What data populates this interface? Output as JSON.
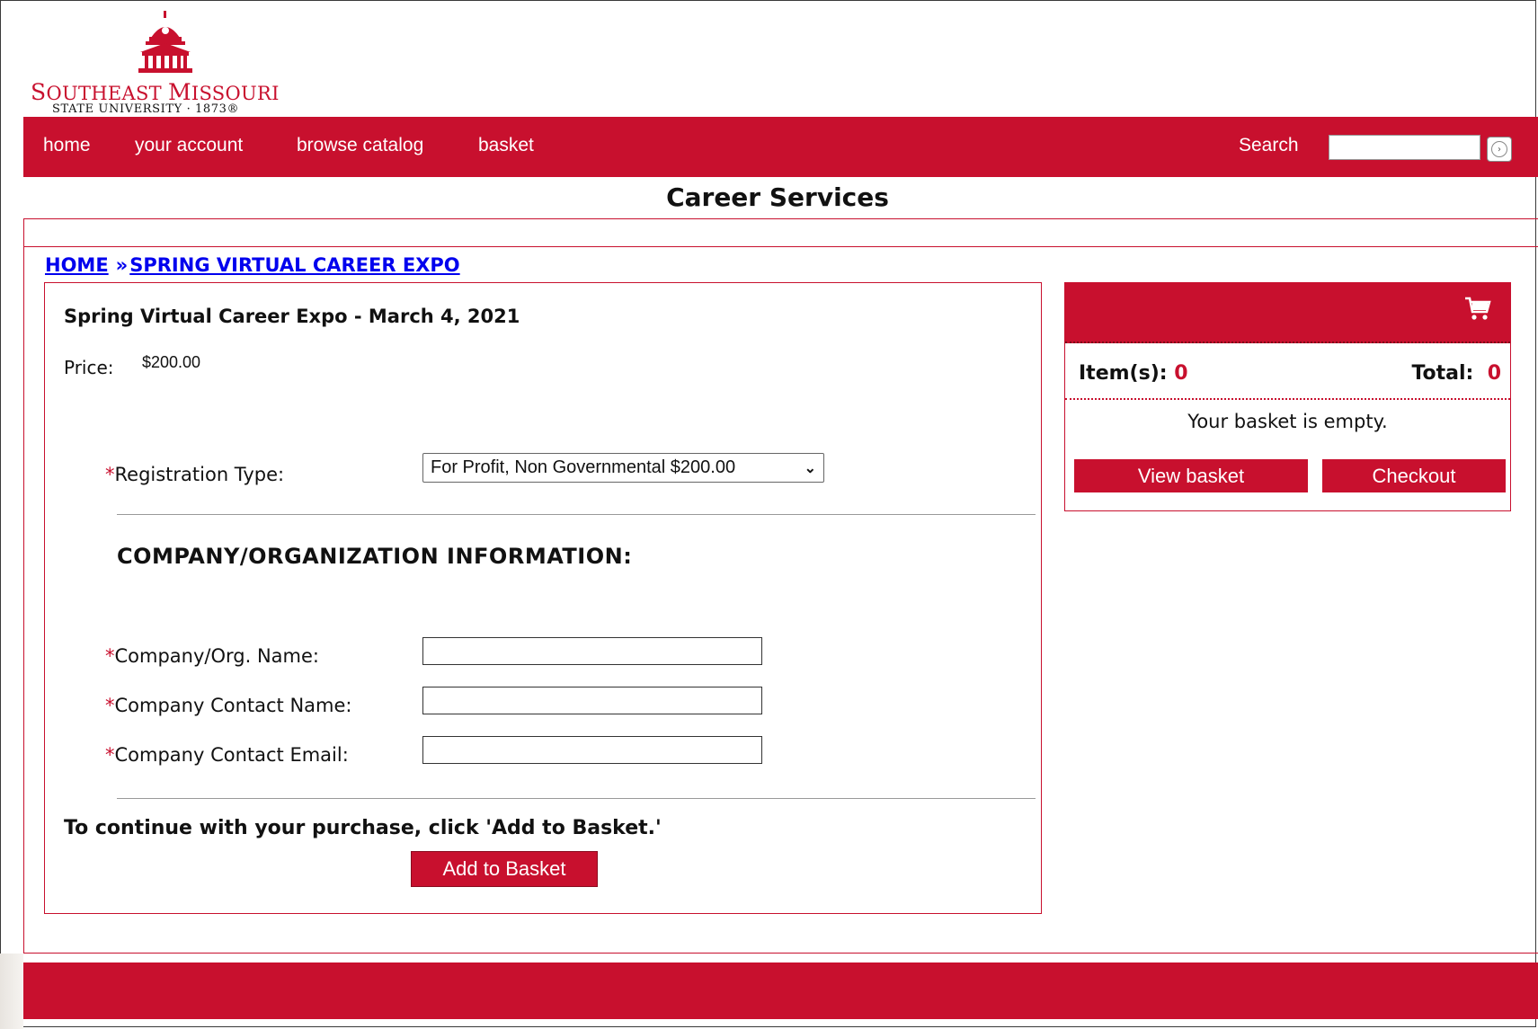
{
  "logo": {
    "name_first_cap": "S",
    "name_first_rest": "OUTHEAST",
    "name_second_cap": "M",
    "name_second_rest": "ISSOURI",
    "subtitle": "STATE UNIVERSITY · 1873®"
  },
  "nav": {
    "items": [
      {
        "label": "home"
      },
      {
        "label": "your account"
      },
      {
        "label": "browse catalog"
      },
      {
        "label": "basket"
      }
    ],
    "search_label": "Search",
    "search_value": ""
  },
  "page_title": "Career Services",
  "breadcrumb": {
    "home": "HOME",
    "separator": "»",
    "current": "SPRING VIRTUAL CAREER EXPO"
  },
  "product": {
    "title": "Spring Virtual Career Expo - March 4, 2021",
    "price_label": "Price:",
    "price_value": "$200.00",
    "required_mark": "*",
    "registration_label": "Registration Type:",
    "registration_selected": "For Profit, Non Governmental $200.00",
    "section_heading": "COMPANY/ORGANIZATION INFORMATION:",
    "fields": [
      {
        "label": "Company/Org. Name:",
        "value": ""
      },
      {
        "label": "Company Contact Name:",
        "value": ""
      },
      {
        "label": "Company Contact Email:",
        "value": ""
      }
    ],
    "continue_text": "To continue with your purchase, click 'Add to Basket.'",
    "add_button": "Add to Basket"
  },
  "basket": {
    "items_label": "Item(s):",
    "items_count": "0",
    "total_label": "Total:",
    "total_value": "0",
    "empty_text": "Your basket is empty.",
    "view_button": "View basket",
    "checkout_button": "Checkout"
  },
  "colors": {
    "brand_red": "#c8102e",
    "link_blue": "#0000ee"
  },
  "icons": [
    "university-dome-logo",
    "search-go-icon",
    "shopping-cart-icon",
    "chevron-down-icon"
  ]
}
